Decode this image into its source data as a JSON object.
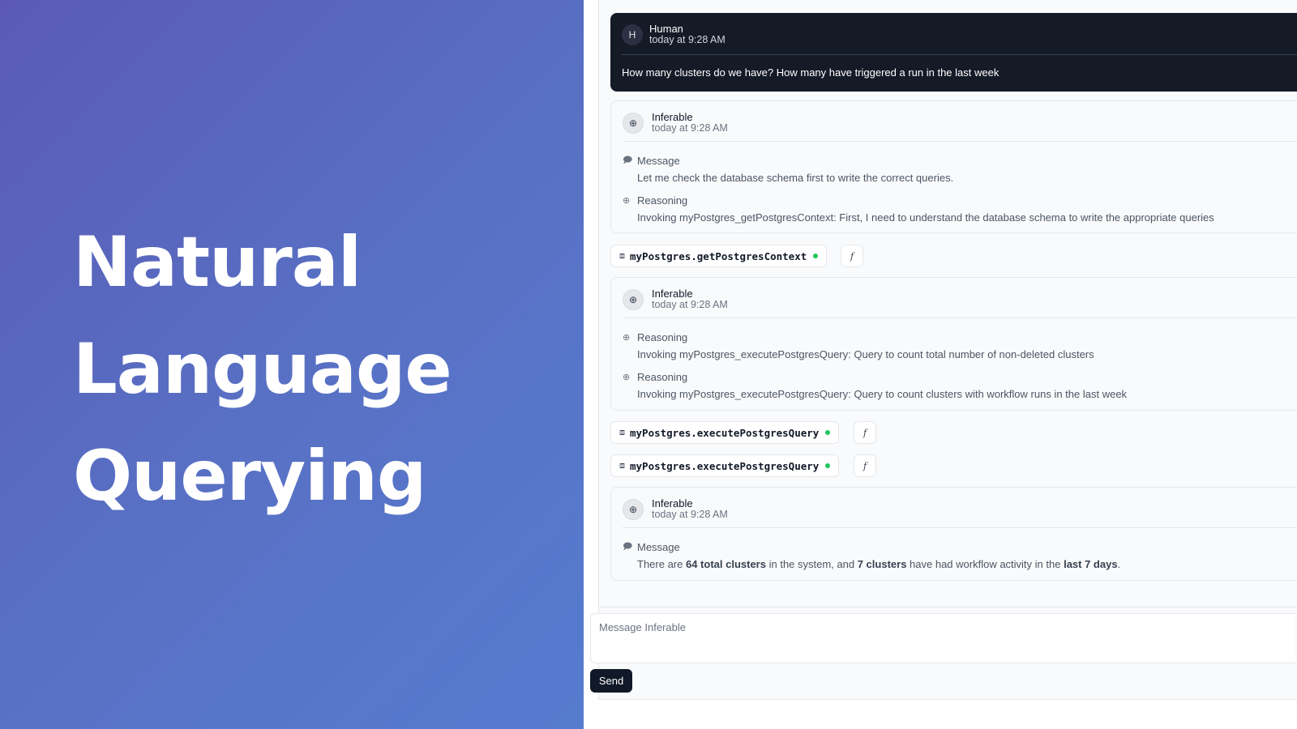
{
  "hero": {
    "line1": "Natural",
    "line2": "Language",
    "line3": "Querying"
  },
  "chat": {
    "human": {
      "avatar": "H",
      "author": "Human",
      "time": "today at 9:28 AM",
      "text": "How many clusters do we have? How many have triggered a run in the last week"
    },
    "card1": {
      "author": "Inferable",
      "time": "today at 9:28 AM",
      "message_label": "Message",
      "message_text": "Let me check the database schema first to write the correct queries.",
      "reasoning_label": "Reasoning",
      "reasoning_text": "Invoking myPostgres_getPostgresContext: First, I need to understand the database schema to write the appropriate queries"
    },
    "tool1": {
      "name": "myPostgres.getPostgresContext"
    },
    "card2": {
      "author": "Inferable",
      "time": "today at 9:28 AM",
      "reasoning1_label": "Reasoning",
      "reasoning1_text": "Invoking myPostgres_executePostgresQuery: Query to count total number of non-deleted clusters",
      "reasoning2_label": "Reasoning",
      "reasoning2_text": "Invoking myPostgres_executePostgresQuery: Query to count clusters with workflow runs in the last week"
    },
    "tool2": {
      "name": "myPostgres.executePostgresQuery"
    },
    "tool3": {
      "name": "myPostgres.executePostgresQuery"
    },
    "card3": {
      "author": "Inferable",
      "time": "today at 9:28 AM",
      "message_label": "Message",
      "text_pre": "There are ",
      "text_b1": "64 total clusters",
      "text_mid1": " in the system, and ",
      "text_b2": "7 clusters",
      "text_mid2": " have had workflow activity in the ",
      "text_b3": "last 7 days",
      "text_post": "."
    }
  },
  "composer": {
    "placeholder": "Message Inferable",
    "send_label": "Send"
  },
  "icons": {
    "message": "message-circle-icon",
    "reasoning": "brain-icon",
    "tool": "cpu-icon",
    "function": "function-icon",
    "agent": "brain-icon"
  },
  "colors": {
    "hero_gradient_start": "#5a5ab4",
    "hero_gradient_end": "#567ccf",
    "human_bubble": "#151a27",
    "status_ok": "#22c55e",
    "send_button": "#111827"
  }
}
